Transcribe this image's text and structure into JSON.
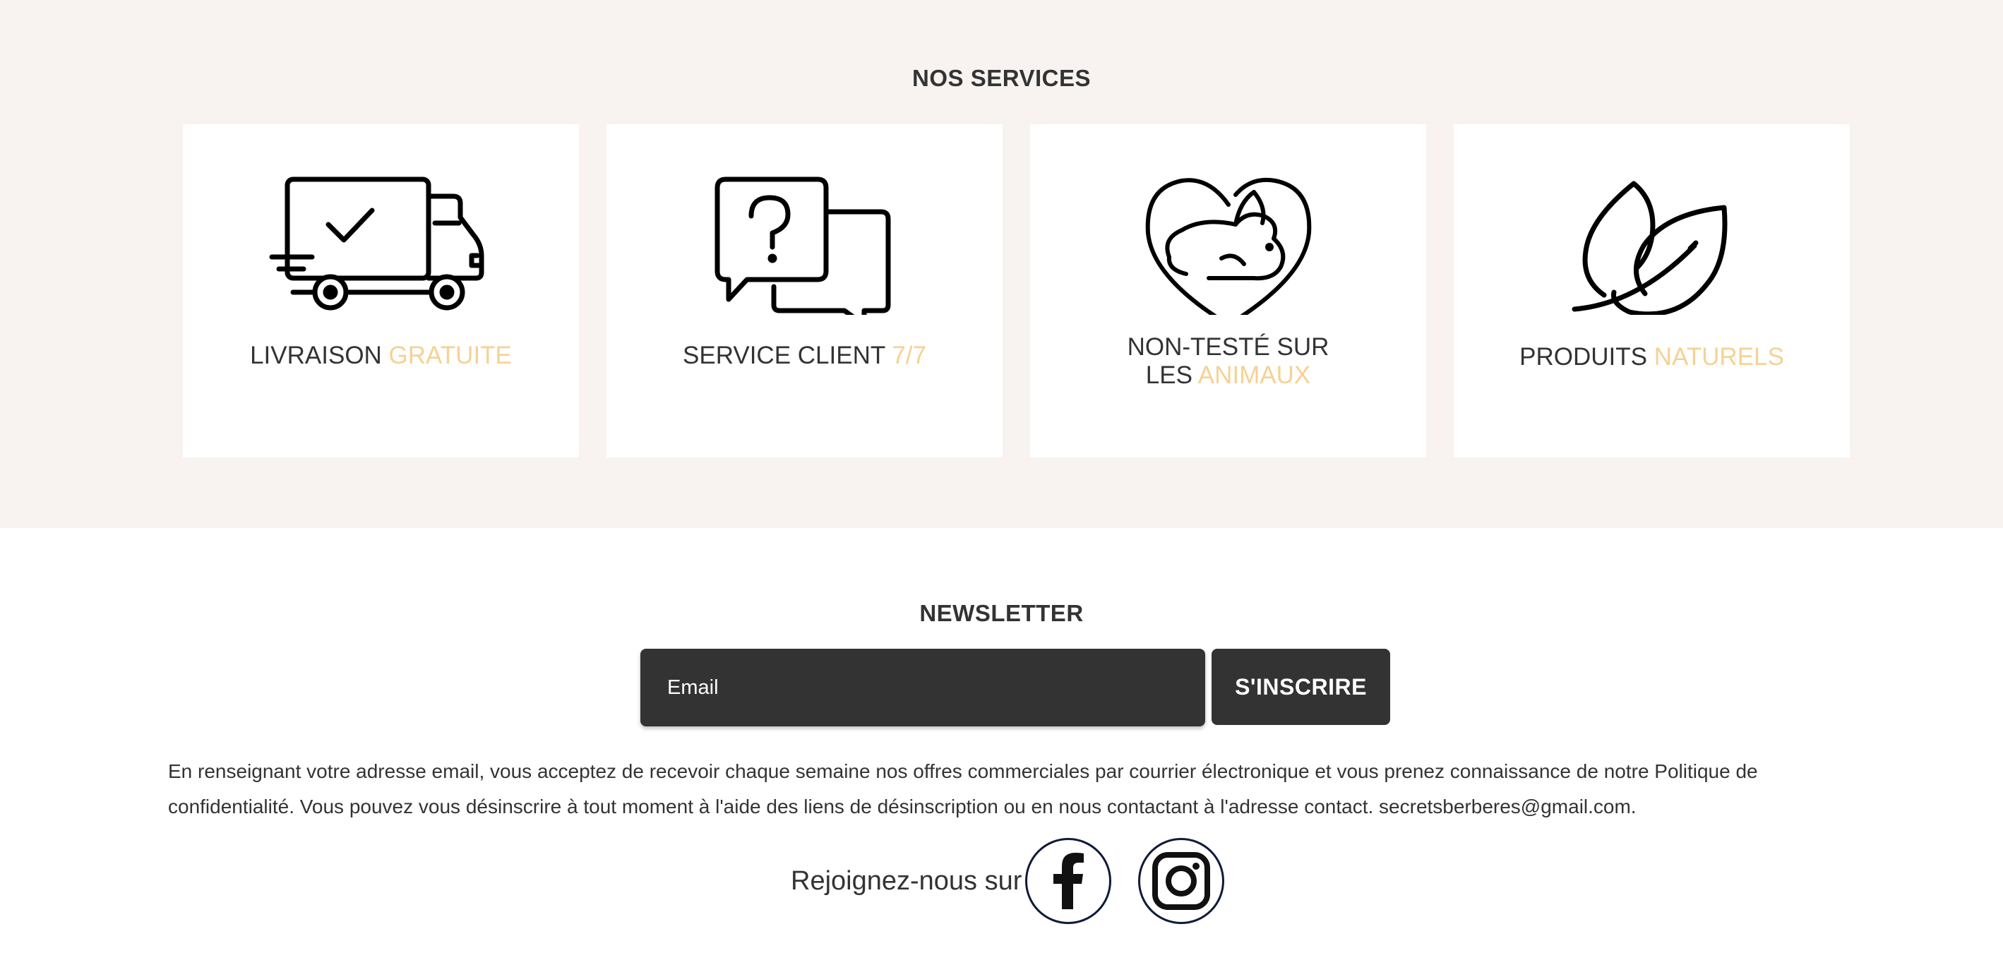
{
  "services": {
    "title": "NOS SERVICES",
    "items": [
      {
        "icon": "delivery-truck-icon",
        "label_main": "LIVRAISON ",
        "label_accent": "GRATUITE"
      },
      {
        "icon": "chat-bubbles-question-icon",
        "label_main": "SERVICE CLIENT ",
        "label_accent": "7/7"
      },
      {
        "icon": "rabbit-heart-icon",
        "label_line1": "NON-TESTÉ SUR",
        "label_main": "LES ",
        "label_accent": "ANIMAUX"
      },
      {
        "icon": "leaves-icon",
        "label_main": "PRODUITS ",
        "label_accent": "NATURELS"
      }
    ]
  },
  "newsletter": {
    "title": "NEWSLETTER",
    "email_placeholder": "Email",
    "email_value": "",
    "subscribe_label": "S'INSCRIRE",
    "disclaimer": "En renseignant votre adresse email, vous acceptez de recevoir chaque semaine nos offres commerciales par courrier électronique et vous prenez connaissance de notre Politique de confidentialité. Vous pouvez vous désinscrire à tout moment à l'aide des liens de désinscription ou en nous contactant à l'adresse contact. secretsberberes@gmail.com."
  },
  "social": {
    "label": "Rejoignez-nous sur",
    "links": [
      {
        "icon": "facebook-icon"
      },
      {
        "icon": "instagram-icon"
      }
    ]
  },
  "colors": {
    "section_bg": "#f8f2f1",
    "accent": "#f5d293",
    "dark": "#333333",
    "social_border": "#0f1a3a"
  }
}
